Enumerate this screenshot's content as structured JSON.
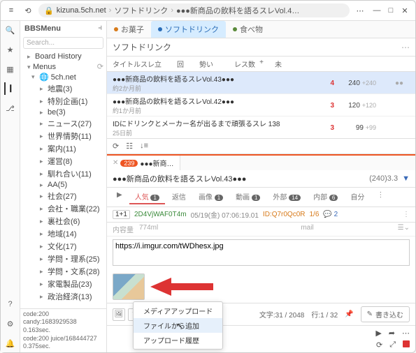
{
  "titlebar": {
    "host": "kizuna.5ch.net",
    "breadcrumb": [
      "ソフトドリンク",
      "●●●新商品の飲料を語るスレVol.4…"
    ]
  },
  "sidebar": {
    "title": "BBSMenu",
    "search_placeholder": "Search...",
    "board_history": "Board History",
    "menus_label": "Menus",
    "root": "5ch.net",
    "items": [
      {
        "label": "地震(3)"
      },
      {
        "label": "特別企画(1)"
      },
      {
        "label": "be(3)"
      },
      {
        "label": "ニュース(27)"
      },
      {
        "label": "世界情勢(11)"
      },
      {
        "label": "案内(11)"
      },
      {
        "label": "運営(8)"
      },
      {
        "label": "馴れ合い(11)"
      },
      {
        "label": "AA(5)"
      },
      {
        "label": "社会(27)"
      },
      {
        "label": "会社・職業(22)"
      },
      {
        "label": "裏社会(6)"
      },
      {
        "label": "地域(14)"
      },
      {
        "label": "文化(17)"
      },
      {
        "label": "学問・理系(25)"
      },
      {
        "label": "学問・文系(28)"
      },
      {
        "label": "家電製品(23)"
      },
      {
        "label": "政治経済(13)"
      }
    ],
    "status": {
      "l1": "code:200",
      "l2": "candy:1683929538",
      "l3": "0.163sec.",
      "l4": "code:200 juice/168444727",
      "l5": "0.375sec."
    }
  },
  "tabs": [
    {
      "label": "お菓子",
      "color": "#d77a1a"
    },
    {
      "label": "ソフトドリンク",
      "color": "#2a6db8",
      "active": true
    },
    {
      "label": "食べ物",
      "color": "#5a8a3a"
    }
  ],
  "board_title": "ソフトドリンク",
  "thead": {
    "title": "タイトル",
    "date": "スレ立",
    "kai": "回",
    "ikioi": "勢い",
    "res": "レス数",
    "plus": "+",
    "mi": "未"
  },
  "threads": [
    {
      "title": "●●●新商品の飲料を語るスレVol.43●●●",
      "sub": "約2か月前",
      "ikioi": "4",
      "res": "240",
      "res_plus": "+240",
      "mi": "●●",
      "hl": true
    },
    {
      "title": "●●●新商品の飲料を語るスレVol.42●●●",
      "sub": "約1か月前",
      "ikioi": "3",
      "res": "120",
      "res_plus": "+120",
      "mi": ""
    },
    {
      "title": "IDにドリンクとメーカー名が出るまで頑張るスレ 138",
      "sub": "25日前",
      "ikioi": "3",
      "res": "99",
      "res_plus": "+99",
      "mi": ""
    }
  ],
  "subtab": {
    "count": "239",
    "label": "●●●新商…"
  },
  "thread_header": {
    "title": "●●●新商品の飲料を語るスレVol.43●●●",
    "stats": "(240)3.3",
    "chev": "▼"
  },
  "filters": {
    "play": "▶",
    "popular": "人気",
    "popular_badge": "1",
    "reply": "返信",
    "image": "画像",
    "image_badge": "1",
    "video": "動画",
    "video_badge": "1",
    "ext": "外部",
    "ext_badge": "14",
    "int": "内部",
    "int_badge": "6",
    "self": "自分"
  },
  "post_meta": {
    "idx": "1+1",
    "name": "2D4VjWAF0T4m",
    "date": "05/19(金) 07:06:19.01",
    "id": "ID:Q7r0Qc0R",
    "frac": "1/6",
    "reply_count": "2"
  },
  "compose": {
    "capacity_label": "内容量",
    "capacity_val": "774ml",
    "mail_label": "mail",
    "body": "https://i.imgur.com/tWDhesx.jpg",
    "chars": "文字:31 / 2048",
    "lines": "行:1 / 32",
    "submit": "書き込む"
  },
  "popup": {
    "i1": "メディアアップロード",
    "i2": "ファイルから追加",
    "i3": "アップロード履歴"
  }
}
